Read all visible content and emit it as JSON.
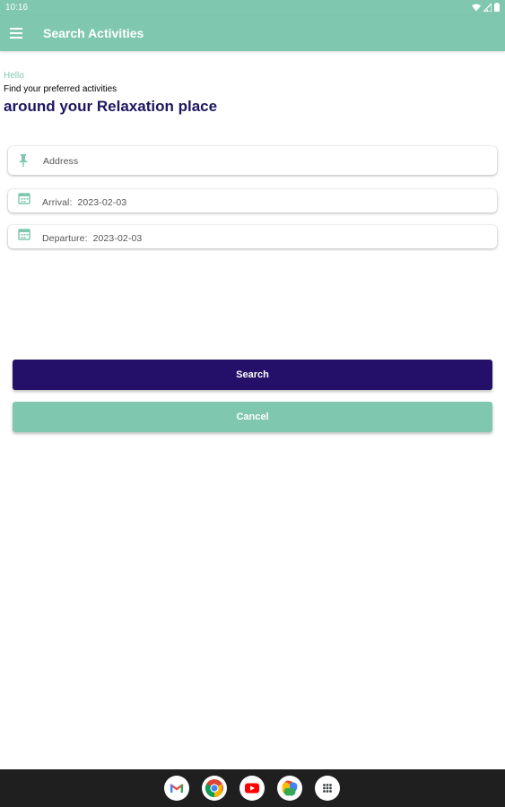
{
  "status_bar": {
    "time": "10:16",
    "icons": [
      "wifi-icon",
      "signal-icon",
      "battery-icon"
    ]
  },
  "app_bar": {
    "title": "Search Activities",
    "menu_icon": "menu-icon"
  },
  "greeting": {
    "hello": "Hello",
    "subtitle": "Find your preferred activities",
    "headline": "around your Relaxation place"
  },
  "form": {
    "address": {
      "placeholder": "Address",
      "icon": "pin-icon"
    },
    "arrival": {
      "label": "Arrival:",
      "value": "2023-02-03",
      "icon": "calendar-icon"
    },
    "departure": {
      "label": "Departure:",
      "value": "2023-02-03",
      "icon": "calendar-icon"
    }
  },
  "buttons": {
    "search": "Search",
    "cancel": "Cancel"
  },
  "dock": {
    "apps": [
      "gmail-icon",
      "chrome-icon",
      "youtube-icon",
      "photos-icon",
      "app-drawer-icon"
    ]
  },
  "colors": {
    "primary": "#80c7b0",
    "accent_dark": "#241069",
    "headline": "#1c1760",
    "nav_bar": "#1f1f1f"
  }
}
